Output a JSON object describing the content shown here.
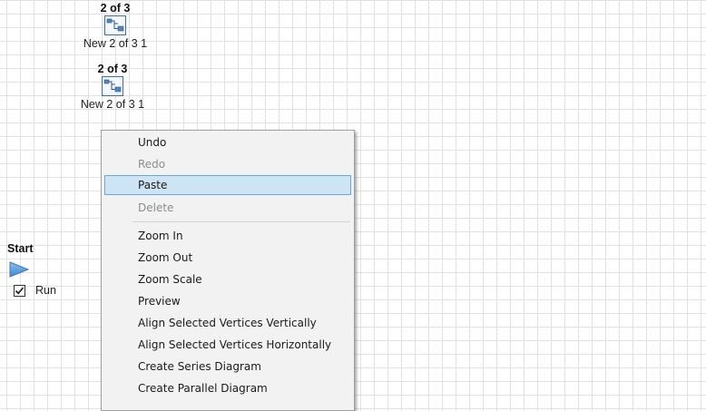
{
  "canvas": {
    "nodes": [
      {
        "title": "2 of 3",
        "label": "New 2 of 3 1",
        "icon": "diagram-node-icon"
      },
      {
        "title": "2 of 3",
        "label": "New 2 of 3 1",
        "icon": "diagram-node-icon"
      }
    ],
    "start": {
      "title": "Start",
      "icon": "play-triangle-icon",
      "run_label": "Run",
      "run_checked": true
    }
  },
  "context_menu": {
    "items": [
      {
        "label": "Undo",
        "enabled": true
      },
      {
        "label": "Redo",
        "enabled": false
      },
      {
        "label": "Paste",
        "enabled": true,
        "highlighted": true
      },
      {
        "label": "Delete",
        "enabled": false
      },
      {
        "label": "Zoom In",
        "enabled": true
      },
      {
        "label": "Zoom Out",
        "enabled": true
      },
      {
        "label": "Zoom Scale",
        "enabled": true
      },
      {
        "label": "Preview",
        "enabled": true
      },
      {
        "label": "Align Selected Vertices Vertically",
        "enabled": true
      },
      {
        "label": "Align Selected Vertices Horizontally",
        "enabled": true
      },
      {
        "label": "Create Series Diagram",
        "enabled": true
      },
      {
        "label": "Create Parallel Diagram",
        "enabled": true
      }
    ]
  },
  "colors": {
    "grid_line": "#e1e1e1",
    "menu_background": "#f2f2f2",
    "menu_highlight": "#cce4f3",
    "menu_highlight_border": "#6aa6d6",
    "start_arrow": "#5b9bd5",
    "node_icon_blue": "#4f86c6"
  }
}
